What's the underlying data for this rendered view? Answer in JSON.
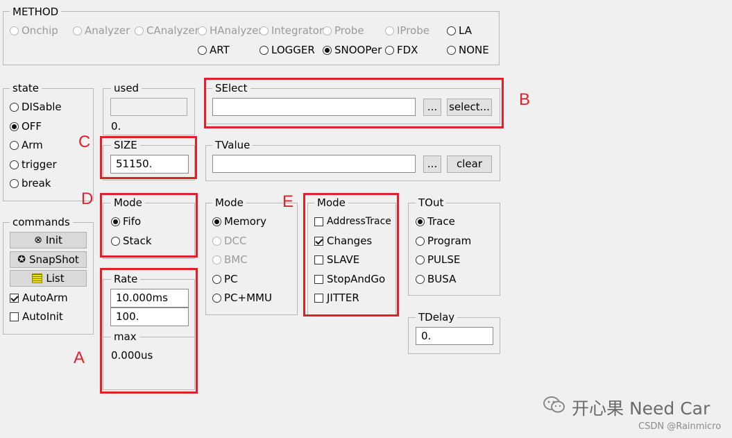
{
  "method": {
    "title": "METHOD",
    "options_row1": [
      {
        "label": "Onchip",
        "enabled": false,
        "selected": false
      },
      {
        "label": "Analyzer",
        "enabled": false,
        "selected": false
      },
      {
        "label": "CAnalyzer",
        "enabled": false,
        "selected": false
      },
      {
        "label": "HAnalyzer",
        "enabled": false,
        "selected": false
      },
      {
        "label": "Integrator",
        "enabled": false,
        "selected": false
      },
      {
        "label": "Probe",
        "enabled": false,
        "selected": false
      },
      {
        "label": "IProbe",
        "enabled": false,
        "selected": false
      },
      {
        "label": "LA",
        "enabled": true,
        "selected": false
      }
    ],
    "options_row2": [
      {
        "label": "ART",
        "enabled": true,
        "selected": false
      },
      {
        "label": "LOGGER",
        "enabled": true,
        "selected": false
      },
      {
        "label": "SNOOPer",
        "enabled": true,
        "selected": true
      },
      {
        "label": "FDX",
        "enabled": true,
        "selected": false
      },
      {
        "label": "NONE",
        "enabled": true,
        "selected": false
      }
    ]
  },
  "state": {
    "title": "state",
    "options": [
      {
        "label": "DISable",
        "selected": false
      },
      {
        "label": "OFF",
        "selected": true
      },
      {
        "label": "Arm",
        "selected": false
      },
      {
        "label": "trigger",
        "selected": false
      },
      {
        "label": "break",
        "selected": false
      }
    ]
  },
  "used": {
    "title": "used",
    "value": "",
    "readout": "0."
  },
  "size": {
    "title": "SIZE",
    "value": "51150."
  },
  "select": {
    "title": "SElect",
    "value": "",
    "browse_label": "...",
    "select_label": "select..."
  },
  "tvalue": {
    "title": "TValue",
    "value": "",
    "browse_label": "...",
    "clear_label": "clear"
  },
  "commands": {
    "title": "commands",
    "buttons": [
      {
        "label": "Init",
        "icon": "reset-icon"
      },
      {
        "label": "SnapShot",
        "icon": "snapshot-icon"
      },
      {
        "label": "List",
        "icon": "list-icon"
      }
    ],
    "checks": [
      {
        "label": "AutoArm",
        "checked": true
      },
      {
        "label": "AutoInit",
        "checked": false
      }
    ]
  },
  "mode_fifo": {
    "title": "Mode",
    "options": [
      {
        "label": "Fifo",
        "selected": true
      },
      {
        "label": "Stack",
        "selected": false
      }
    ]
  },
  "mode_memory": {
    "title": "Mode",
    "options": [
      {
        "label": "Memory",
        "enabled": true,
        "selected": true
      },
      {
        "label": "DCC",
        "enabled": false,
        "selected": false
      },
      {
        "label": "BMC",
        "enabled": false,
        "selected": false
      },
      {
        "label": "PC",
        "enabled": true,
        "selected": false
      },
      {
        "label": "PC+MMU",
        "enabled": true,
        "selected": false
      }
    ]
  },
  "mode_trace": {
    "title": "Mode",
    "options": [
      {
        "label": "AddressTrace",
        "checked": false
      },
      {
        "label": "Changes",
        "checked": true
      },
      {
        "label": "SLAVE",
        "checked": false
      },
      {
        "label": "StopAndGo",
        "checked": false
      },
      {
        "label": "JITTER",
        "checked": false
      }
    ]
  },
  "tout": {
    "title": "TOut",
    "options": [
      {
        "label": "Trace",
        "selected": true
      },
      {
        "label": "Program",
        "selected": false
      },
      {
        "label": "PULSE",
        "selected": false
      },
      {
        "label": "BUSA",
        "selected": false
      }
    ]
  },
  "rate": {
    "title": "Rate",
    "value1": "10.000ms",
    "value2": "100.",
    "max_title": "max",
    "max_value": "0.000us"
  },
  "tdelay": {
    "title": "TDelay",
    "value": "0."
  },
  "annotations": {
    "A": "A",
    "B": "B",
    "C": "C",
    "D": "D",
    "E": "E",
    "color": "#e0202a"
  },
  "watermark": {
    "main": "开心果 Need Car",
    "sub": "CSDN @Rainmicro"
  }
}
